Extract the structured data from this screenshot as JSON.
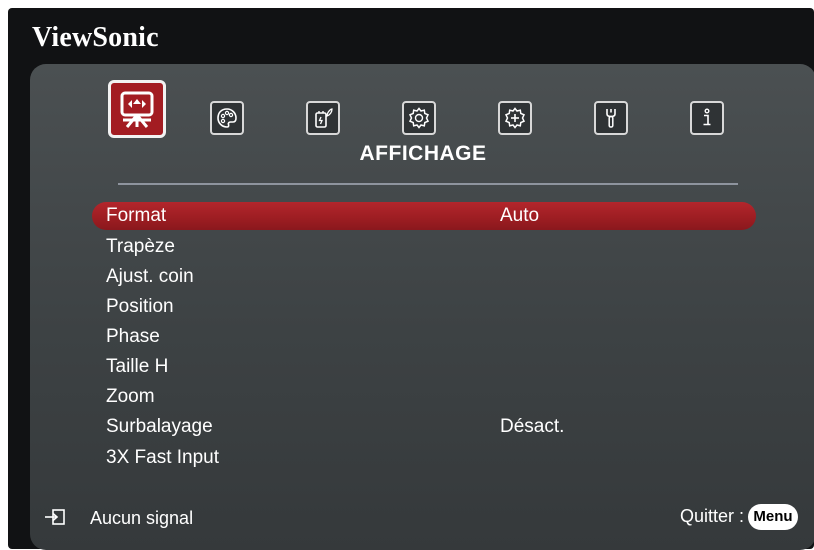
{
  "brand": "ViewSonic",
  "tabs": [
    {
      "icon": "display-icon",
      "active": true
    },
    {
      "icon": "palette-icon",
      "active": false
    },
    {
      "icon": "power-eco-icon",
      "active": false
    },
    {
      "icon": "settings-gear-icon",
      "active": false
    },
    {
      "icon": "advanced-gear-icon",
      "active": false
    },
    {
      "icon": "wrench-icon",
      "active": false
    },
    {
      "icon": "info-icon",
      "active": false
    }
  ],
  "section_title": "AFFICHAGE",
  "menu": {
    "items": [
      {
        "label": "Format",
        "value": "Auto",
        "selected": true
      },
      {
        "label": "Trapèze",
        "value": ""
      },
      {
        "label": "Ajust. coin",
        "value": ""
      },
      {
        "label": "Position",
        "value": ""
      },
      {
        "label": "Phase",
        "value": ""
      },
      {
        "label": "Taille H",
        "value": ""
      },
      {
        "label": "Zoom",
        "value": ""
      },
      {
        "label": "Surbalayage",
        "value": "Désact."
      },
      {
        "label": "3X Fast Input",
        "value": ""
      }
    ]
  },
  "footer": {
    "source_icon": "input-source-icon",
    "status": "Aucun signal",
    "exit_label": "Quitter :",
    "menu_button": "Menu"
  },
  "colors": {
    "accent": "#a31c22",
    "panel": "#454a4c",
    "background": "#111214",
    "text": "#ffffff"
  }
}
